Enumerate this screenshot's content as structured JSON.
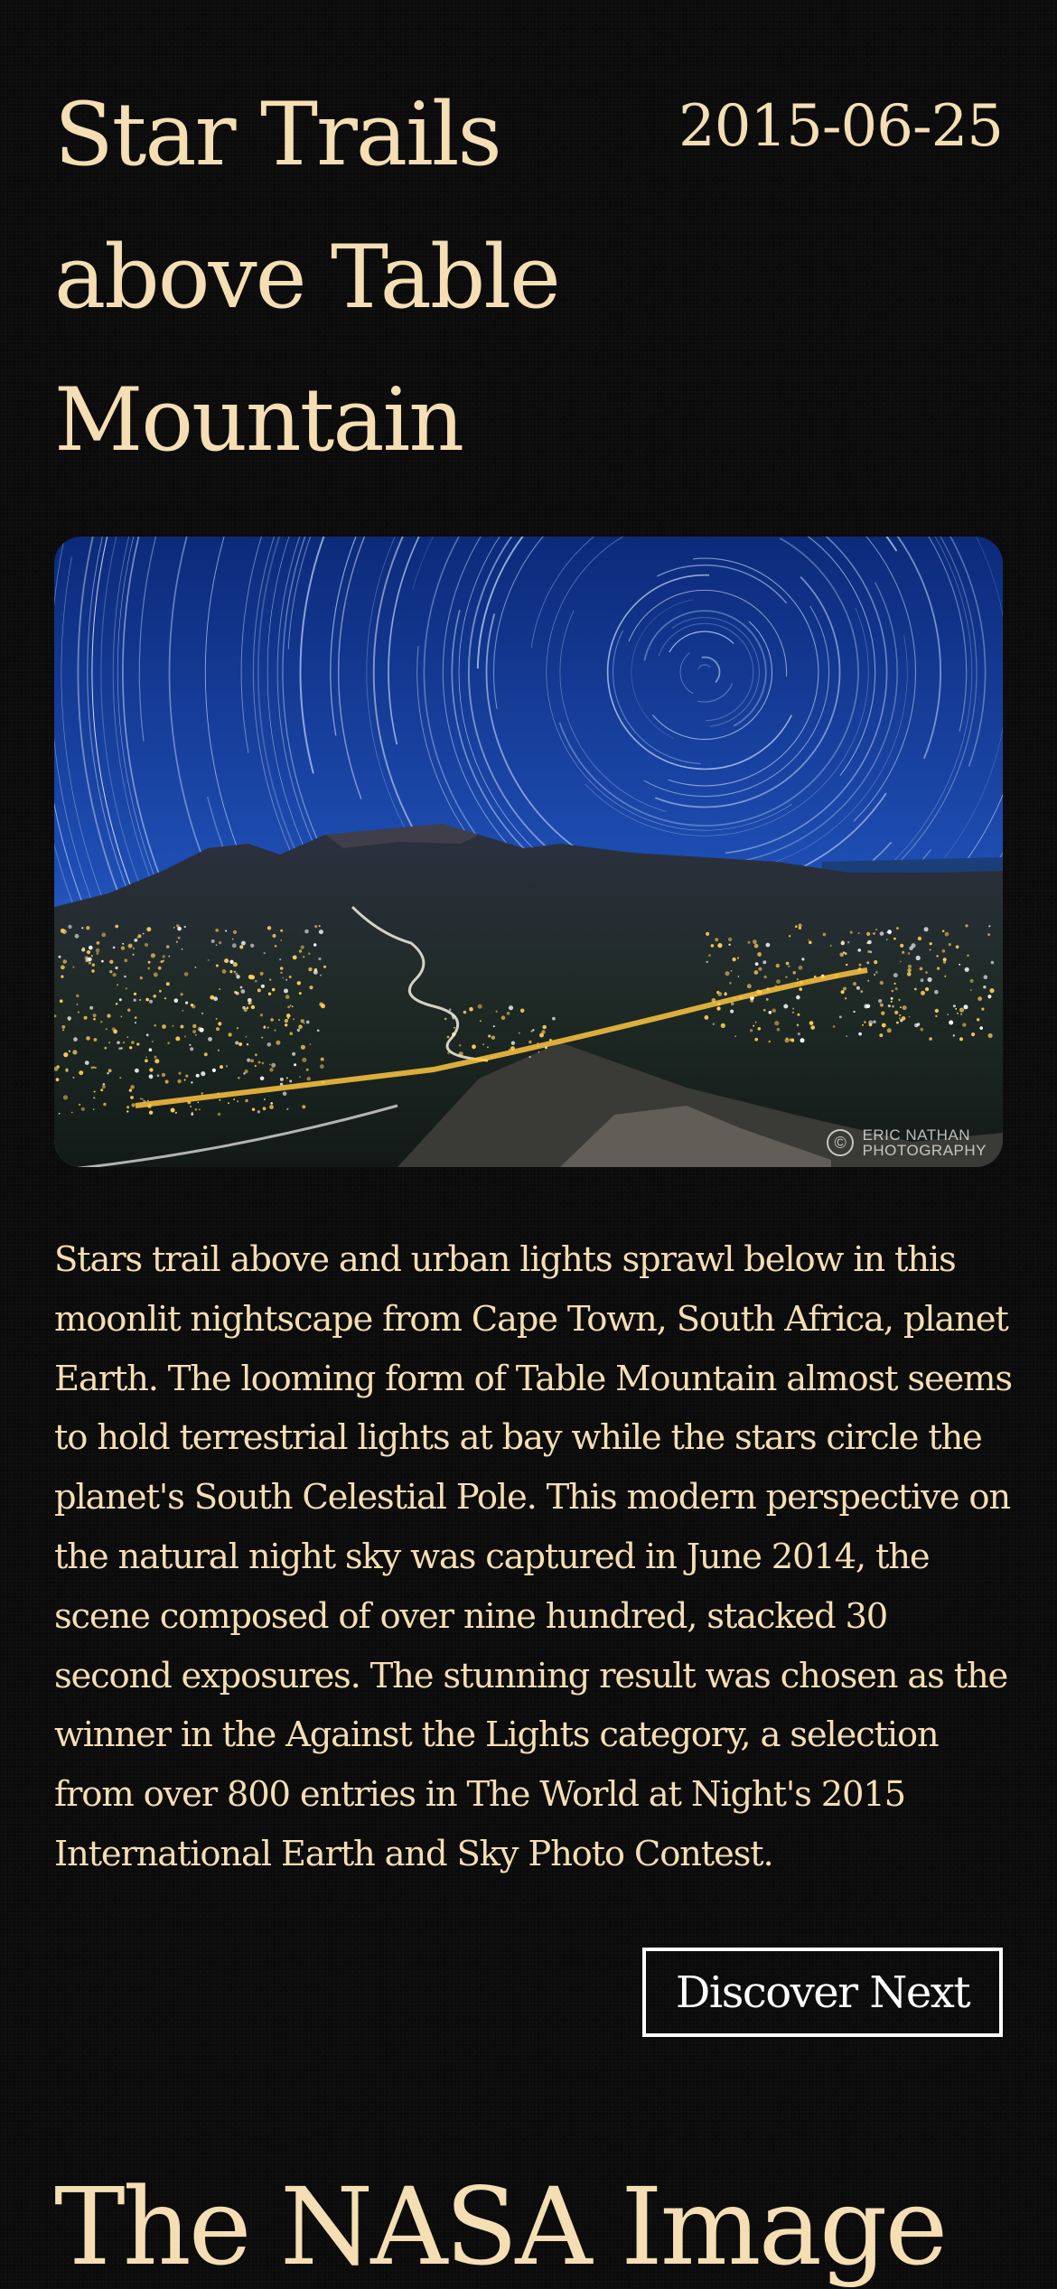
{
  "article": {
    "title": "Star Trails above Table Mountain",
    "date": "2015-06-25",
    "image": {
      "credit_line1": "ERIC NATHAN",
      "credit_line2": "PHOTOGRAPHY",
      "copyright_symbol": "©"
    },
    "description": "Stars trail above and urban lights sprawl below in this moonlit nightscape from Cape Town, South Africa, planet Earth. The looming form of Table Mountain almost seems to hold terrestrial lights at bay while the stars circle the planet's South Celestial Pole. This modern perspective on the natural night sky was captured in June 2014, the scene composed of over nine hundred, stacked 30 second exposures. The stunning result was chosen as the winner in the Against the Lights category, a selection from over 800 entries in The World at Night's 2015 International Earth and Sky Photo Contest.",
    "discover_label": "Discover Next"
  },
  "footer": {
    "title": "The NASA Image"
  },
  "colors": {
    "background": "#0b0b0b",
    "text": "#f5deb3",
    "button_border": "#ffffff",
    "sky": "#1a3f9a"
  }
}
